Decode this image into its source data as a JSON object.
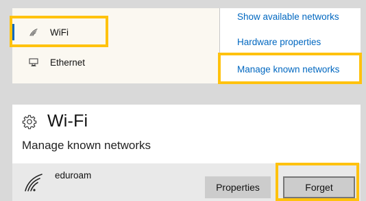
{
  "network_nav": {
    "items": [
      {
        "label": "WiFi",
        "icon": "wifi-icon",
        "selected": true
      },
      {
        "label": "Ethernet",
        "icon": "ethernet-icon",
        "selected": false
      }
    ]
  },
  "related_links": [
    "Show available networks",
    "Hardware properties",
    "Manage known networks"
  ],
  "wifi_page": {
    "title": "Wi-Fi",
    "title_icon": "gear-icon",
    "subtitle": "Manage known networks",
    "networks": [
      {
        "ssid": "eduroam",
        "icon": "wifi-signal-icon"
      }
    ],
    "buttons": {
      "properties": "Properties",
      "forget": "Forget"
    }
  },
  "colors": {
    "accent": "#0067c0",
    "highlight": "#ffc20e",
    "background": "#d9d9d9"
  }
}
